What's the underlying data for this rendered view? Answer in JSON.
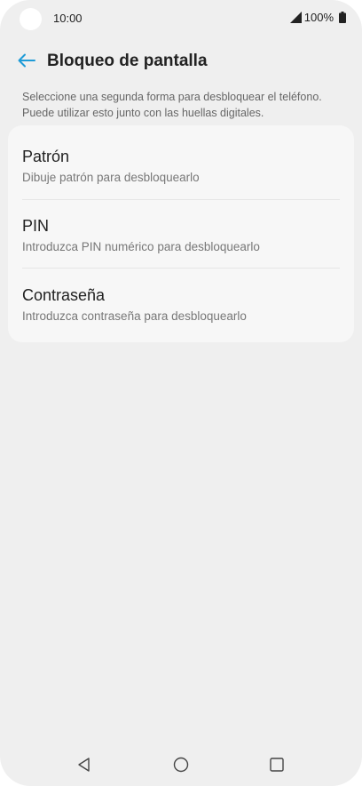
{
  "status_bar": {
    "time": "10:00",
    "battery": "100%"
  },
  "header": {
    "title": "Bloqueo de pantalla",
    "back_icon": "arrow-left-icon",
    "accent_color": "#1e9bd7"
  },
  "description": "Seleccione una segunda forma para desbloquear el teléfono. Puede utilizar esto junto con las huellas digitales.",
  "options": [
    {
      "title": "Patrón",
      "subtitle": "Dibuje patrón para desbloquearlo"
    },
    {
      "title": "PIN",
      "subtitle": "Introduzca PIN numérico para desbloquearlo"
    },
    {
      "title": "Contraseña",
      "subtitle": "Introduzca contraseña para desbloquearlo"
    }
  ],
  "nav_bar": {
    "back_icon": "triangle-back-icon",
    "home_icon": "circle-home-icon",
    "recents_icon": "square-recents-icon"
  }
}
